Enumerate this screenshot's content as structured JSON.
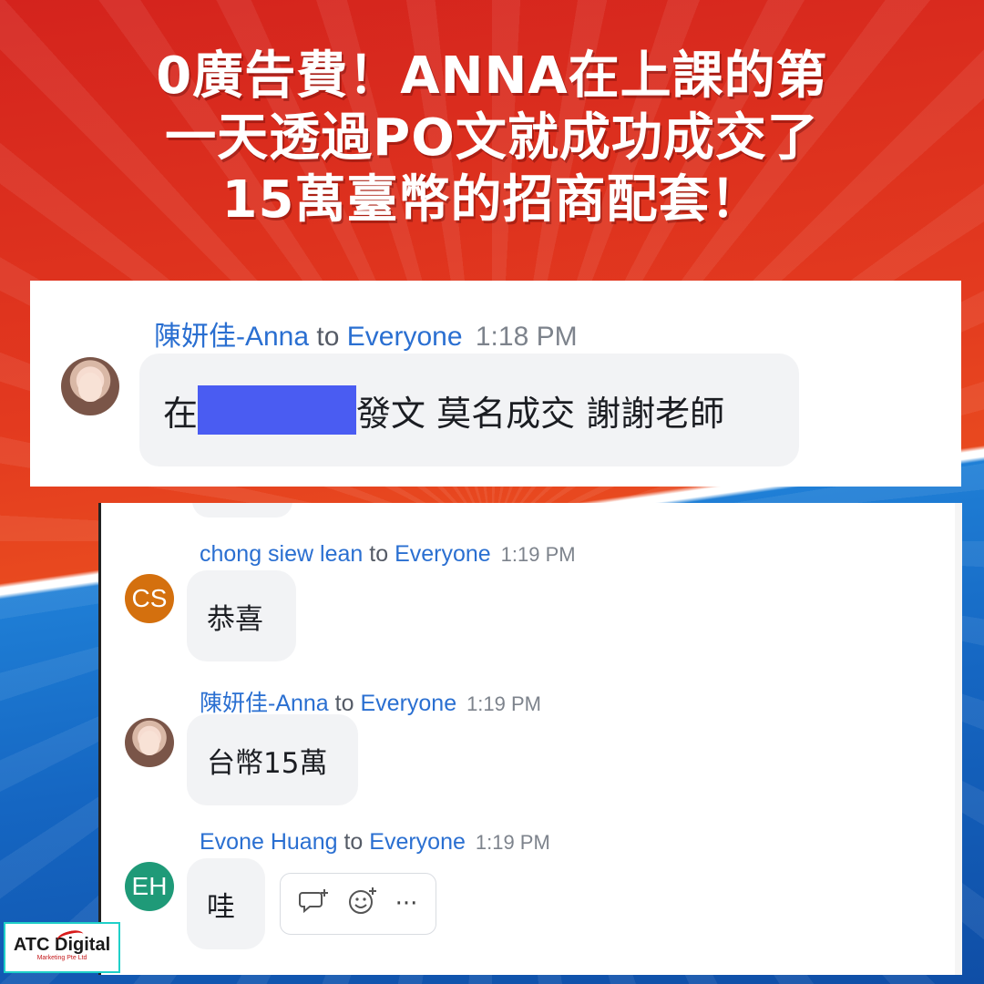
{
  "headline": {
    "line1": "0廣告費！ANNA在上課的第",
    "line2": "一天透過PO文就成功成交了",
    "line3": "15萬臺幣的招商配套！"
  },
  "colors": {
    "bg_red": "#d4231d",
    "bg_blue": "#1566c2",
    "sender_blue": "#2a6fd1",
    "redaction": "#4a5cf2",
    "avatar_cs": "#d4700e",
    "avatar_eh": "#1f9a78"
  },
  "chat_top": {
    "message": {
      "sender": "陳妍佳-Anna",
      "to": "to",
      "recipient": "Everyone",
      "time": "1:18 PM",
      "text_before": "在",
      "text_after": "發文 莫名成交 謝謝老師",
      "avatar": "profile-photo"
    }
  },
  "chat_bottom": {
    "messages": [
      {
        "sender": "chong siew lean",
        "to": "to",
        "recipient": "Everyone",
        "time": "1:19 PM",
        "text": "恭喜",
        "avatar_initials": "CS"
      },
      {
        "sender": "陳妍佳-Anna",
        "to": "to",
        "recipient": "Everyone",
        "time": "1:19 PM",
        "text": "台幣15萬",
        "avatar": "profile-photo"
      },
      {
        "sender": "Evone Huang",
        "to": "to",
        "recipient": "Everyone",
        "time": "1:19 PM",
        "text": "哇",
        "avatar_initials": "EH"
      }
    ],
    "reactions": {
      "reply_icon": "comment-plus-icon",
      "emoji_icon": "emoji-plus-icon",
      "more_label": "···"
    }
  },
  "logo": {
    "main": "ATC Digital",
    "sub": "Marketing Pte Ltd"
  }
}
